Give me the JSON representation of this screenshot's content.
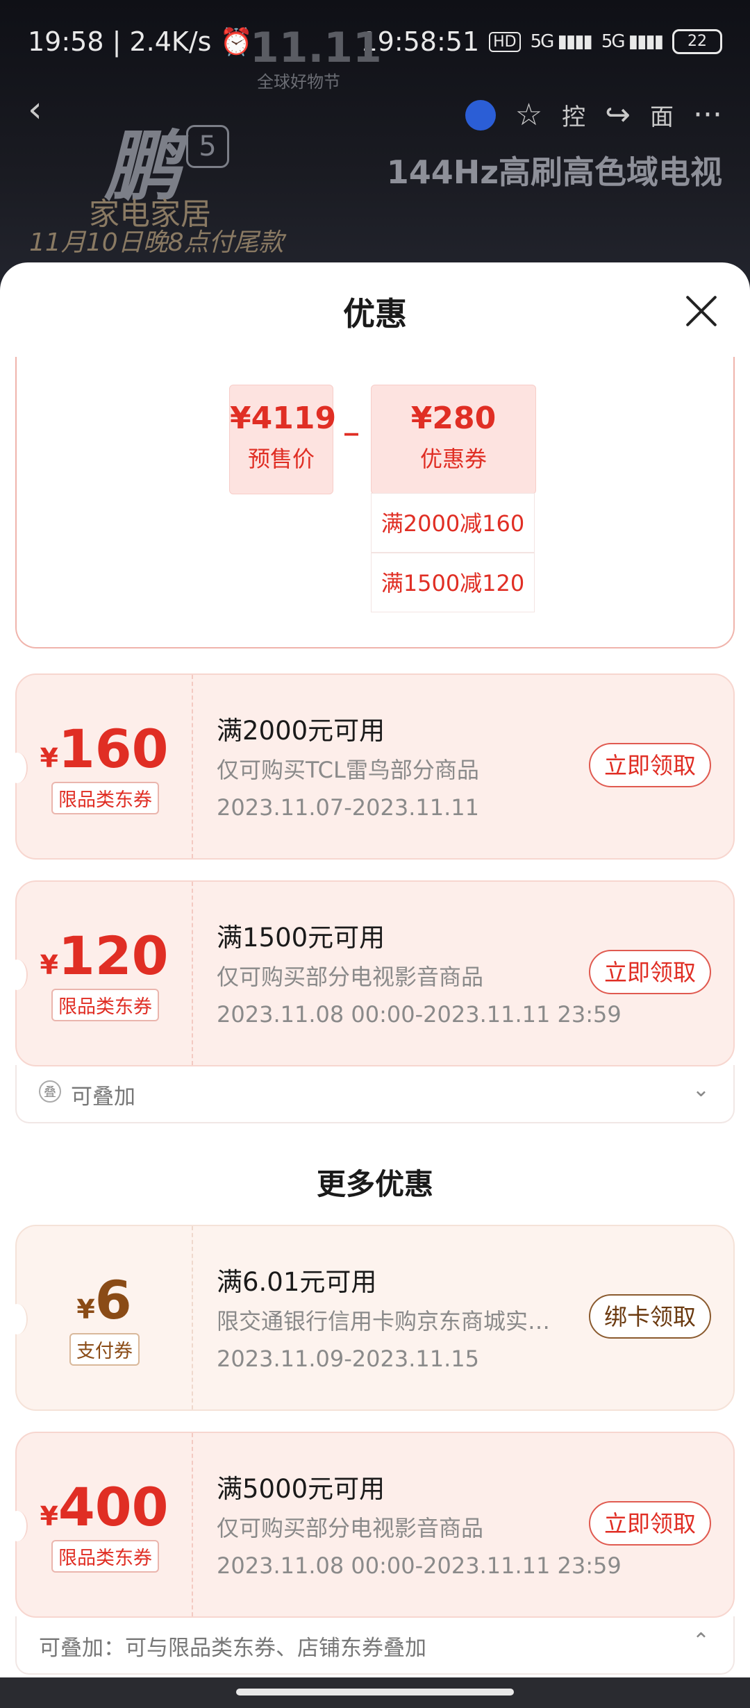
{
  "status_bar": {
    "left": "19:58 | 2.4K/s ⏰",
    "clock": "19:58:51",
    "hd": "HD",
    "signal1": "5G ▮▮▮▮",
    "signal2": "5G ▮▮▮▮",
    "battery": "22"
  },
  "background": {
    "brand": "11.11",
    "brand_sub": "全球好物节",
    "peng": "鹏",
    "peng_num": "5",
    "line1": "家电家居",
    "line2": "11月10日晚8点付尾款",
    "promo": "144Hz高刷高色域电视",
    "icon_tag1": "控",
    "icon_tag2": "面"
  },
  "sheet": {
    "title": "优惠",
    "calc": {
      "presale_amount": "¥4119",
      "presale_label": "预售价",
      "minus": "_",
      "coupon_amount": "¥280",
      "coupon_label": "优惠券",
      "sub_items": [
        "满2000减160",
        "满1500减120"
      ]
    },
    "coupons": [
      {
        "yen": "¥",
        "value": "160",
        "kind": "限品类东券",
        "condition": "满2000元可用",
        "desc": "仅可购买TCL雷鸟部分商品",
        "date": "2023.11.07-2023.11.11",
        "button": "立即领取"
      },
      {
        "yen": "¥",
        "value": "120",
        "kind": "限品类东券",
        "condition": "满1500元可用",
        "desc": "仅可购买部分电视影音商品",
        "date": "2023.11.08 00:00-2023.11.11 23:59",
        "button": "立即领取"
      }
    ],
    "stack_note": "可叠加",
    "stack_icon": "叠",
    "more_title": "更多优惠",
    "more_coupons": [
      {
        "yen": "¥",
        "value": "6",
        "kind": "支付券",
        "condition": "满6.01元可用",
        "desc": "限交通银行信用卡购京东商城实体商品",
        "date": "2023.11.09-2023.11.15",
        "button": "绑卡领取"
      },
      {
        "yen": "¥",
        "value": "400",
        "kind": "限品类东券",
        "condition": "满5000元可用",
        "desc": "仅可购买部分电视影音商品",
        "date": "2023.11.08 00:00-2023.11.11 23:59",
        "button": "立即领取"
      }
    ],
    "stack_note2": "可叠加：可与限品类东券、店铺东券叠加"
  }
}
